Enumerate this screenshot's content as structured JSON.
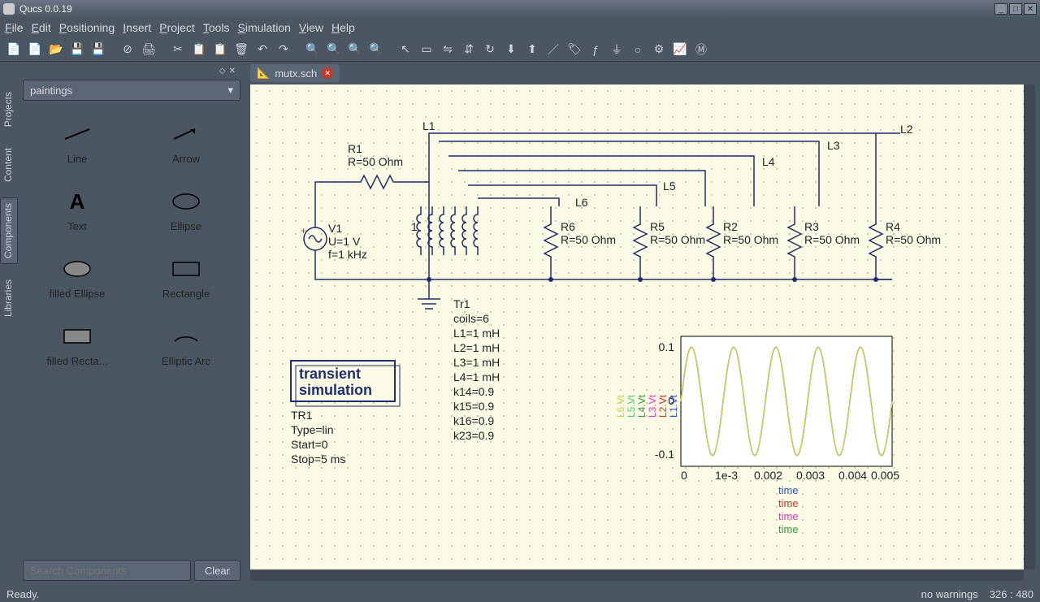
{
  "window": {
    "title": "Qucs 0.0.19"
  },
  "menu": {
    "file": "File",
    "edit": "Edit",
    "positioning": "Positioning",
    "insert": "Insert",
    "project": "Project",
    "tools": "Tools",
    "simulation": "Simulation",
    "view": "View",
    "help": "Help"
  },
  "side_tabs": {
    "projects": "Projects",
    "content": "Content",
    "components": "Components",
    "libraries": "Libraries"
  },
  "sidebar": {
    "category": "paintings",
    "search_placeholder": "Search Components",
    "clear": "Clear",
    "items": [
      {
        "label": "Line"
      },
      {
        "label": "Arrow"
      },
      {
        "label": "Text"
      },
      {
        "label": "Ellipse"
      },
      {
        "label": "filled Ellipse"
      },
      {
        "label": "Rectangle"
      },
      {
        "label": "filled Recta..."
      },
      {
        "label": "Elliptic Arc"
      }
    ]
  },
  "tabs": {
    "active": "mutx.sch"
  },
  "schematic": {
    "r1": {
      "name": "R1",
      "value": "R=50 Ohm"
    },
    "v1": {
      "name": "V1",
      "u": "U=1 V",
      "f": "f=1 kHz"
    },
    "probes": {
      "l1": "L1",
      "l2": "L2",
      "l3": "L3",
      "l4": "L4",
      "l5": "L5",
      "l6": "L6"
    },
    "resistors": {
      "r6": {
        "name": "R6",
        "value": "R=50 Ohm"
      },
      "r5": {
        "name": "R5",
        "value": "R=50 Ohm"
      },
      "r2": {
        "name": "R2",
        "value": "R=50 Ohm"
      },
      "r3": {
        "name": "R3",
        "value": "R=50 Ohm"
      },
      "r4": {
        "name": "R4",
        "value": "R=50 Ohm"
      }
    },
    "transformer": {
      "name": "Tr1",
      "params": [
        "coils=6",
        "L1=1 mH",
        "L2=1 mH",
        "L3=1 mH",
        "L4=1 mH",
        "k14=0.9",
        "k15=0.9",
        "k16=0.9",
        "k23=0.9"
      ]
    },
    "sim": {
      "title1": "transient",
      "title2": "simulation",
      "name": "TR1",
      "params": [
        "Type=lin",
        "Start=0",
        "Stop=5 ms"
      ]
    }
  },
  "plot": {
    "legend": [
      "L6.Vt",
      "L5.Vt",
      "L4.Vt",
      "L3.Vt",
      "L2.Vt",
      "L1.Vt"
    ],
    "legend_colors": [
      "#d4cf4a",
      "#55c779",
      "#2a9b3d",
      "#e335c4",
      "#c0392b",
      "#2a4fd4"
    ],
    "y_ticks": [
      "0.1",
      "0",
      "-0.1"
    ],
    "x_ticks": [
      "0",
      "1e-3",
      "0.002",
      "0.003",
      "0.004",
      "0.005"
    ],
    "xlabels": [
      "time",
      "time",
      "time",
      "time"
    ],
    "xlabel_colors": [
      "#2a4fd4",
      "#c0392b",
      "#e335c4",
      "#2a9b3d"
    ]
  },
  "status": {
    "ready": "Ready.",
    "warnings": "no warnings",
    "coords": "326 : 480"
  },
  "chart_data": {
    "type": "line",
    "title": "",
    "xlabel": "time",
    "ylabel": "",
    "xlim": [
      0,
      0.005
    ],
    "ylim": [
      -0.12,
      0.12
    ],
    "x_ticks": [
      0,
      0.001,
      0.002,
      0.003,
      0.004,
      0.005
    ],
    "y_ticks": [
      -0.1,
      0,
      0.1
    ],
    "series": [
      {
        "name": "L1.Vt",
        "color": "#2a4fd4",
        "amplitude": 0.1,
        "frequency_hz": 1000,
        "phase_deg": 0,
        "note": "sinusoid 1 kHz over 0–5 ms"
      },
      {
        "name": "L2.Vt",
        "color": "#c0392b",
        "amplitude": 0.1,
        "frequency_hz": 1000,
        "phase_deg": 0
      },
      {
        "name": "L3.Vt",
        "color": "#e335c4",
        "amplitude": 0.1,
        "frequency_hz": 1000,
        "phase_deg": 0
      },
      {
        "name": "L4.Vt",
        "color": "#2a9b3d",
        "amplitude": 0.1,
        "frequency_hz": 1000,
        "phase_deg": 0
      },
      {
        "name": "L5.Vt",
        "color": "#55c779",
        "amplitude": 0.1,
        "frequency_hz": 1000,
        "phase_deg": 0
      },
      {
        "name": "L6.Vt",
        "color": "#d4cf4a",
        "amplitude": 0.1,
        "frequency_hz": 1000,
        "phase_deg": 0
      }
    ]
  }
}
